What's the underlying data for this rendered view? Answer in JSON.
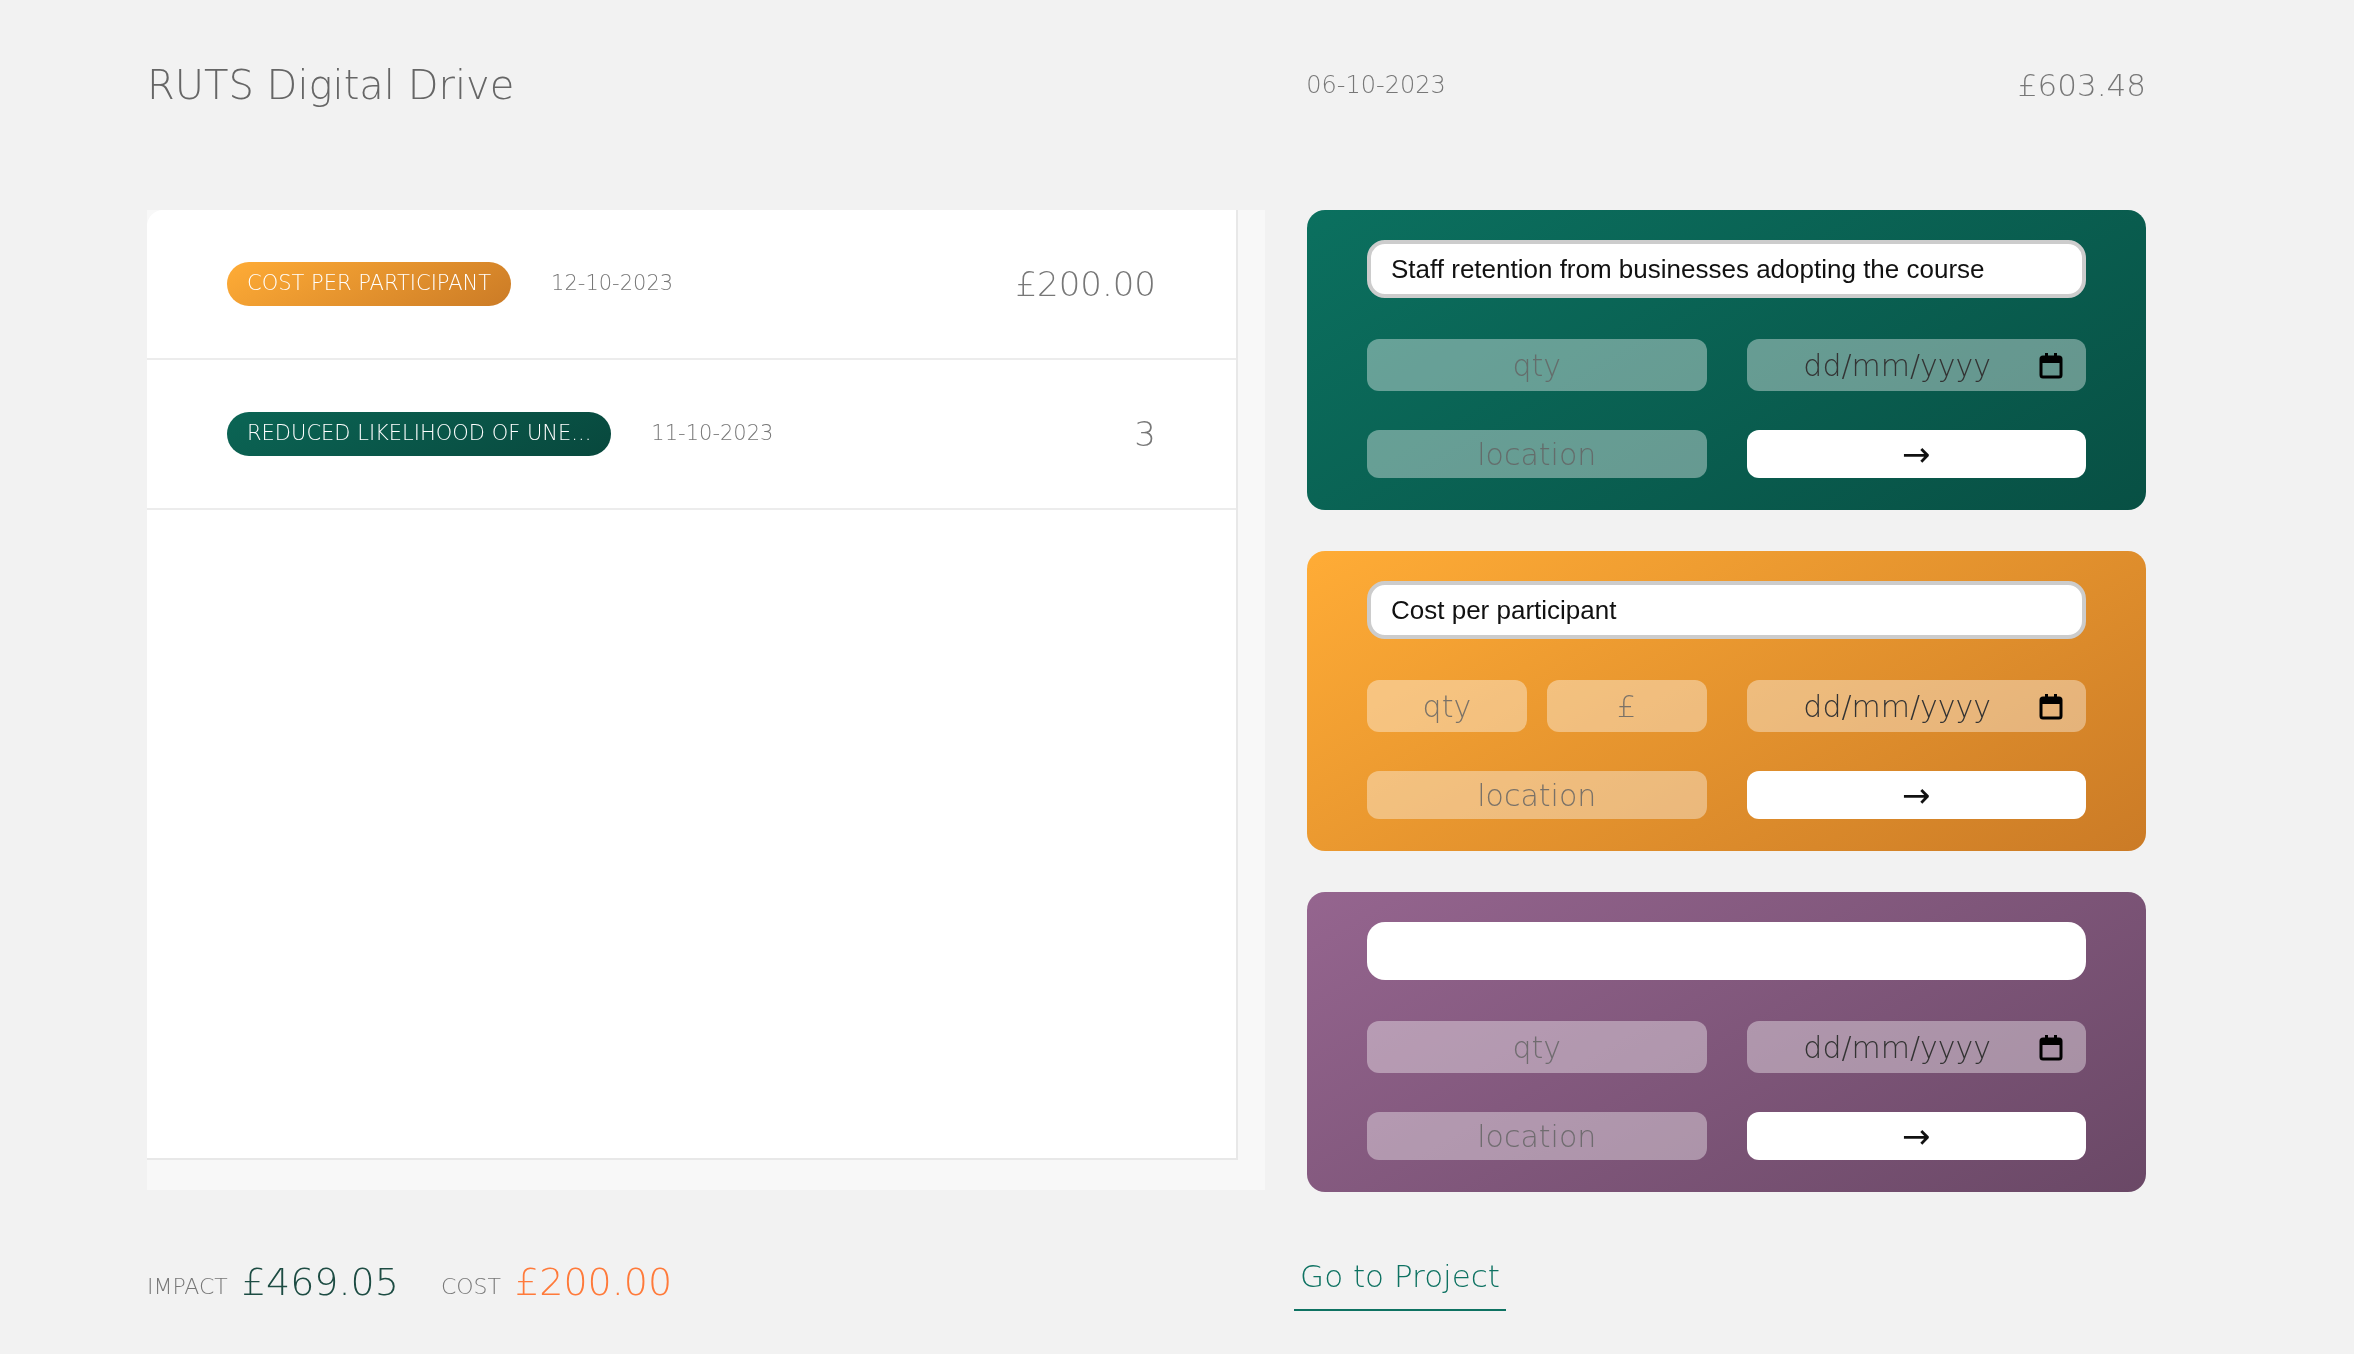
{
  "header": {
    "title": "RUTS Digital Drive",
    "date": "06-10-2023",
    "total": "£603.48"
  },
  "entries": [
    {
      "label": "COST PER PARTICIPANT",
      "date": "12-10-2023",
      "value": "£200.00",
      "color": "#fe9a30"
    },
    {
      "label": "REDUCED LIKELIHOOD OF UNE...",
      "date": "11-10-2023",
      "value": "3",
      "color": "#0a5a4c"
    }
  ],
  "cards": [
    {
      "color": "#0a6455",
      "title": "Staff retention from businesses adopting the course",
      "fields": [
        {
          "placeholder": "qty"
        }
      ],
      "date_placeholder": "dd/mm/yyyy",
      "location_placeholder": "location",
      "submit": "→"
    },
    {
      "color": "#fe9a30",
      "title": "Cost per participant",
      "fields": [
        {
          "placeholder": "qty"
        },
        {
          "placeholder": "£"
        }
      ],
      "date_placeholder": "dd/mm/yyyy",
      "location_placeholder": "location",
      "submit": "→"
    },
    {
      "color": "#855a80",
      "fields": [
        {
          "placeholder": "qty"
        }
      ],
      "date_placeholder": "dd/mm/yyyy",
      "location_placeholder": "location",
      "submit": "→"
    }
  ],
  "footer": {
    "impact_label": "IMPACT",
    "impact_value": "£469.05",
    "cost_label": "COST",
    "cost_value": "£200.00",
    "link": "Go to Project"
  }
}
